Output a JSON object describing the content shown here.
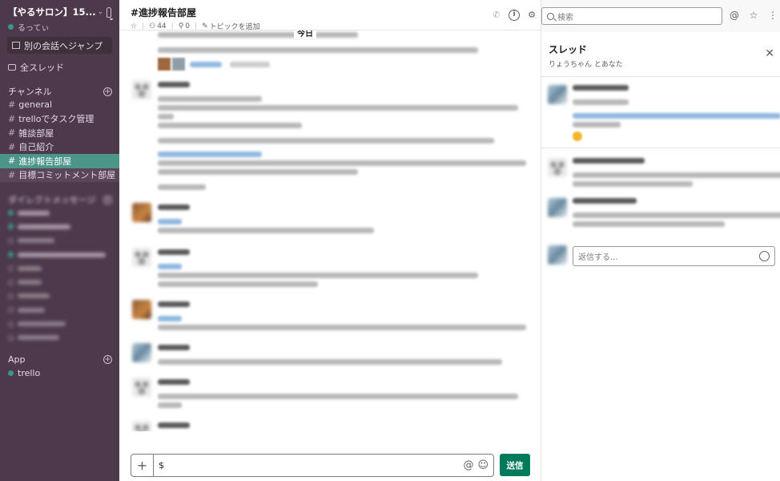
{
  "workspace": {
    "name": "【やるサロン】15...",
    "user": "るってぃ"
  },
  "sidebar": {
    "jump_label": "別の会話へジャンプ",
    "all_threads": "全スレッド",
    "channels_label": "チャンネル",
    "channels": [
      {
        "name": "general",
        "active": false
      },
      {
        "name": "trelloでタスク管理",
        "active": false
      },
      {
        "name": "雑談部屋",
        "active": false
      },
      {
        "name": "自己紹介",
        "active": false
      },
      {
        "name": "進捗報告部屋",
        "active": true
      },
      {
        "name": "目標コミットメント部屋",
        "active": false
      }
    ],
    "dm_label": "ダイレクトメッセージ",
    "apps_label": "App",
    "apps": [
      {
        "name": "trello"
      }
    ]
  },
  "channel": {
    "title": "#進捗報告部屋",
    "members": "44",
    "pins": "0",
    "topic": "トピックを追加",
    "today_label": "今日"
  },
  "composer": {
    "value": "$",
    "send_label": "送信"
  },
  "search": {
    "placeholder": "検索"
  },
  "thread": {
    "title": "スレッド",
    "subtitle": "りょうちゃん とあなた",
    "reply_placeholder": "返信する..."
  }
}
